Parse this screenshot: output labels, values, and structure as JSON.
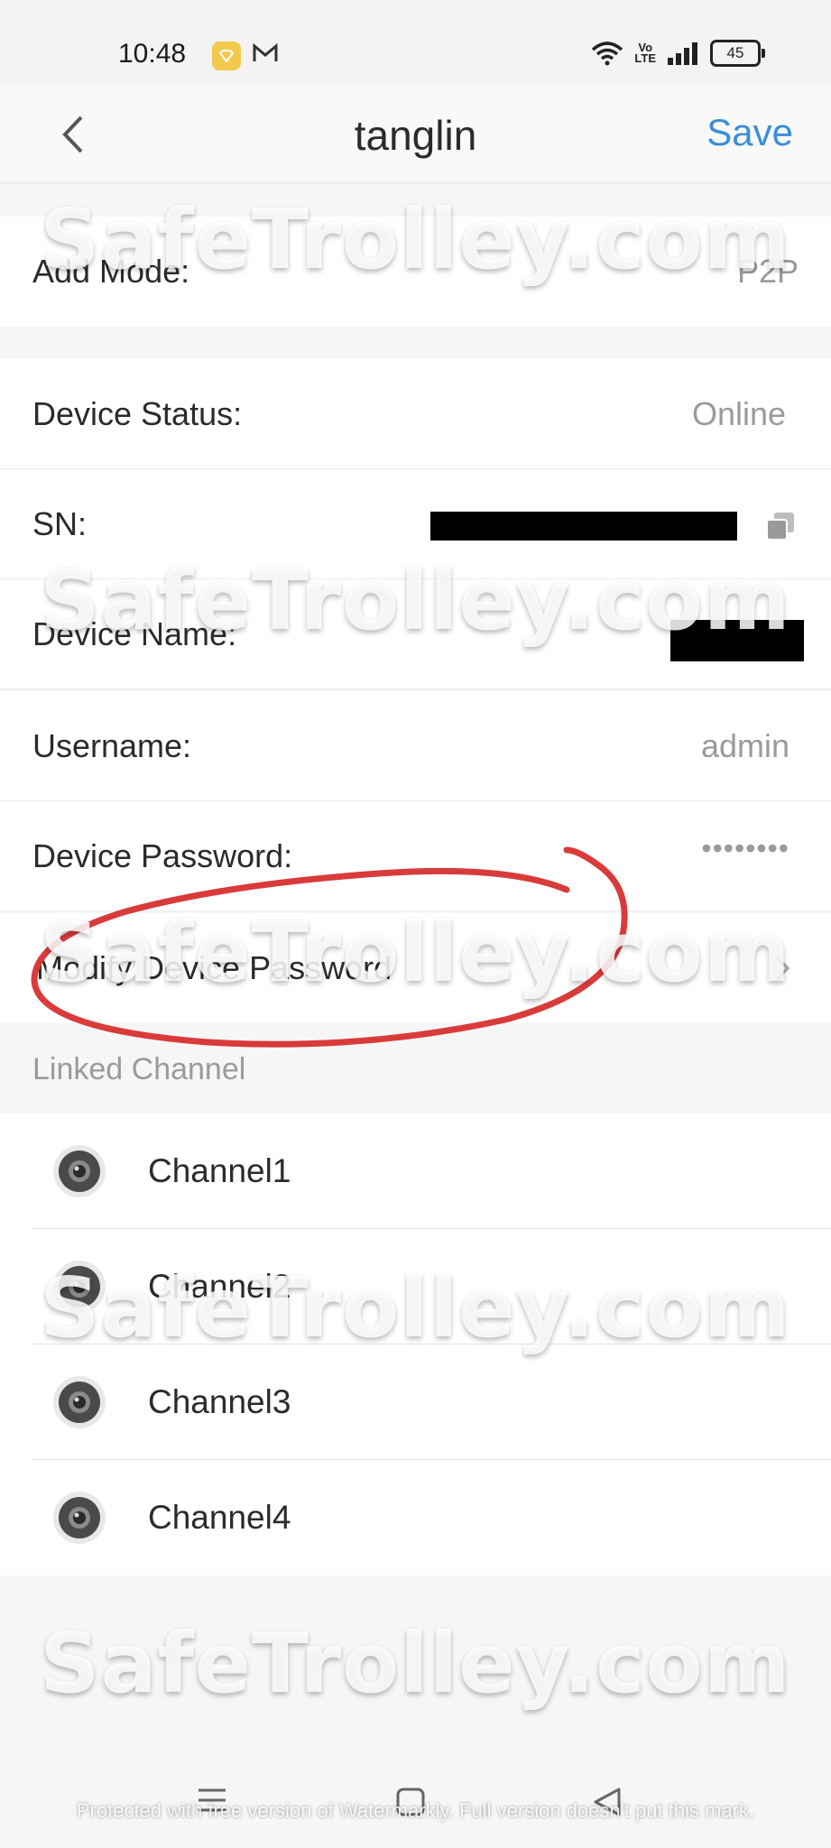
{
  "status_bar": {
    "time": "10:48",
    "battery": "45",
    "volte": "Vo\nLTE"
  },
  "nav": {
    "title": "tanglin",
    "save_label": "Save",
    "accent_color": "#3b8edb"
  },
  "rows": {
    "add_mode": {
      "label": "Add Mode:",
      "value": "P2P"
    },
    "device_status": {
      "label": "Device Status:",
      "value": "Online"
    },
    "sn": {
      "label": "SN:"
    },
    "device_name": {
      "label": "Device Name:"
    },
    "username": {
      "label": "Username:",
      "value": "admin"
    },
    "device_password": {
      "label": "Device Password:",
      "value": "••••••••"
    },
    "modify_password": {
      "label": "Modify Device Password"
    }
  },
  "linked_channel": {
    "header": "Linked Channel",
    "channels": [
      "Channel1",
      "Channel2",
      "Channel3",
      "Channel4"
    ]
  },
  "watermark": {
    "text": "SafeTrolley.com",
    "note": "Protected with free version of Watermarkly. Full version doesn't put this mark."
  },
  "icons": {
    "back": "chevron-left-icon",
    "copy": "copy-icon",
    "chevron": "chevron-right-icon",
    "camera": "camera-icon"
  },
  "annotation_color": "#d93b3b"
}
